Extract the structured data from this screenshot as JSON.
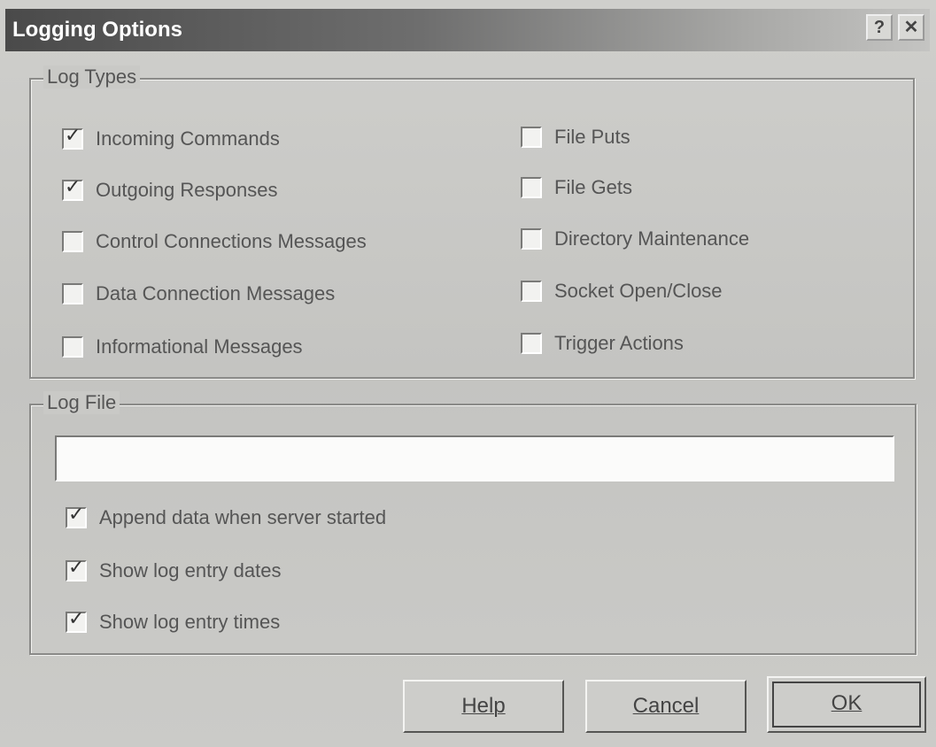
{
  "window": {
    "title": "Logging Options",
    "help_glyph": "?",
    "close_glyph": "✕"
  },
  "log_types": {
    "legend": "Log Types",
    "left": [
      {
        "label": "Incoming Commands",
        "checked": true
      },
      {
        "label": "Outgoing Responses",
        "checked": true
      },
      {
        "label": "Control Connections Messages",
        "checked": false
      },
      {
        "label": "Data Connection Messages",
        "checked": false
      },
      {
        "label": "Informational Messages",
        "checked": false
      }
    ],
    "right": [
      {
        "label": "File Puts",
        "checked": false
      },
      {
        "label": "File Gets",
        "checked": false
      },
      {
        "label": "Directory Maintenance",
        "checked": false
      },
      {
        "label": "Socket Open/Close",
        "checked": false
      },
      {
        "label": "Trigger Actions",
        "checked": false
      }
    ]
  },
  "log_file": {
    "legend": "Log File",
    "path_value": "",
    "options": [
      {
        "label": "Append data when server started",
        "checked": true
      },
      {
        "label": "Show log entry dates",
        "checked": true
      },
      {
        "label": "Show log entry times",
        "checked": true
      }
    ]
  },
  "buttons": {
    "help": "Help",
    "cancel": "Cancel",
    "ok": "OK"
  },
  "check_glyph": "✓",
  "icons": {
    "help": "help-icon",
    "close": "close-icon"
  }
}
